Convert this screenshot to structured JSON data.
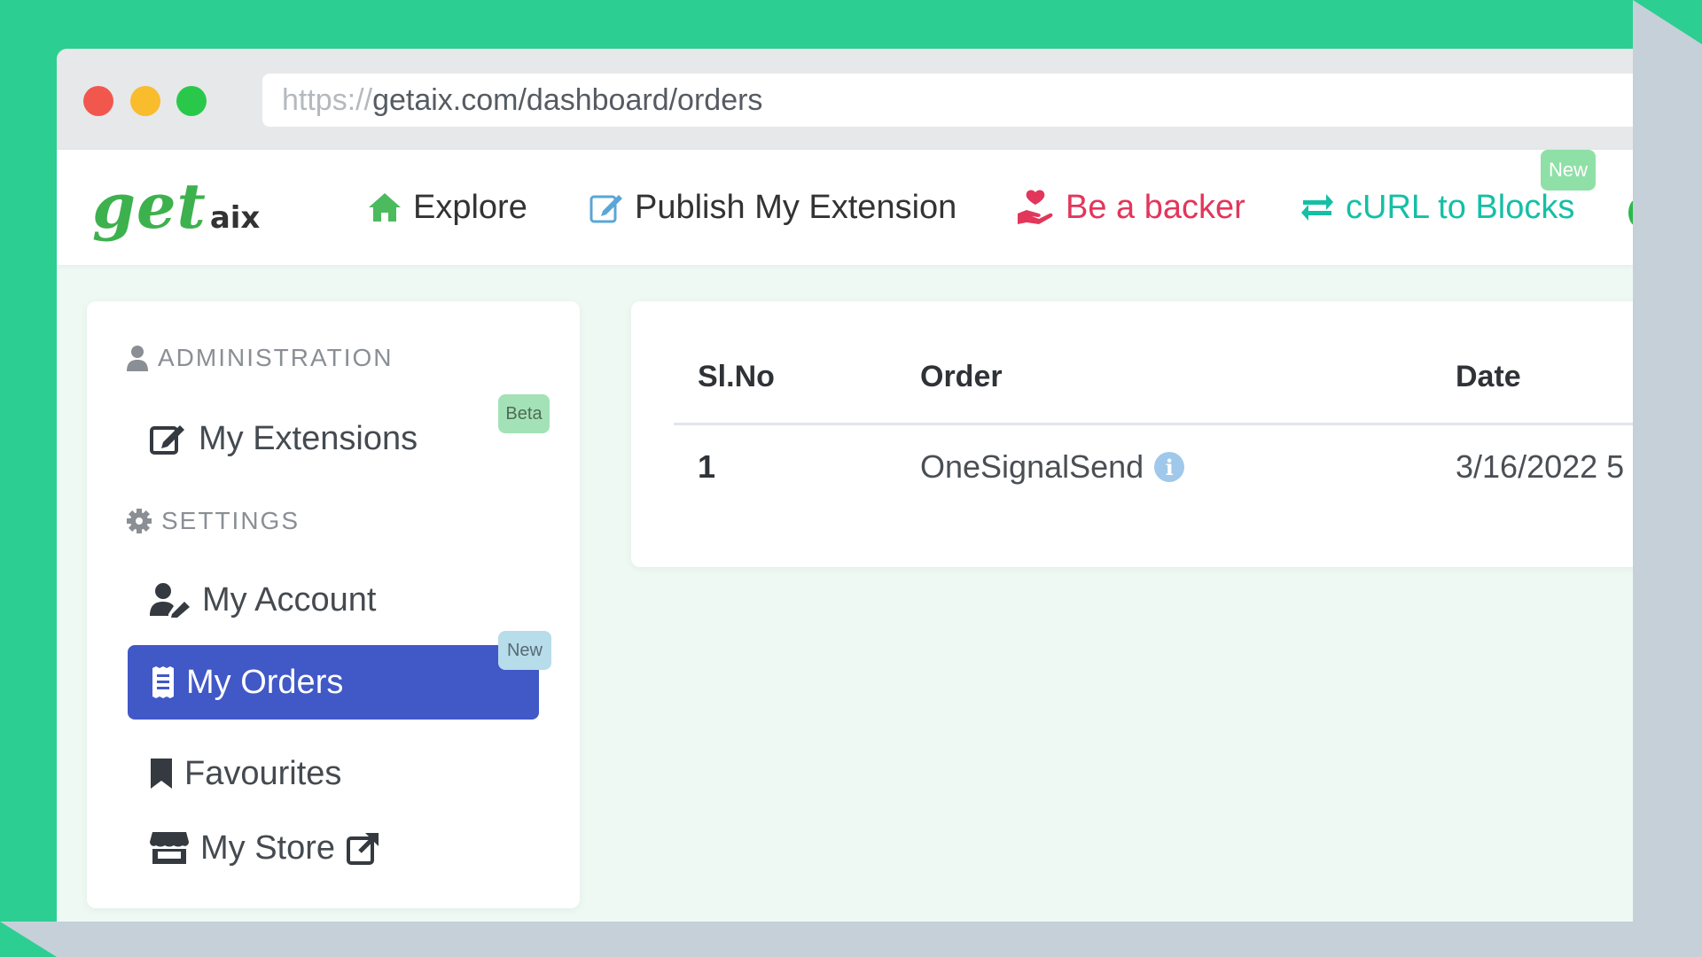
{
  "browser": {
    "url_protocol": "https://",
    "url_path": "getaix.com/dashboard/orders"
  },
  "logo": {
    "main": "get",
    "sub": "aix"
  },
  "nav": {
    "explore": "Explore",
    "publish": "Publish My Extension",
    "backer": "Be a backer",
    "curl": "cURL to Blocks",
    "new_badge": "New"
  },
  "sidebar": {
    "administration": "ADMINISTRATION",
    "my_extensions": "My Extensions",
    "beta_badge": "Beta",
    "settings": "SETTINGS",
    "my_account": "My Account",
    "my_orders": "My Orders",
    "orders_badge": "New",
    "favourites": "Favourites",
    "my_store": "My Store"
  },
  "table": {
    "columns": [
      "Sl.No",
      "Order",
      "Date"
    ],
    "rows": [
      {
        "slno": "1",
        "order": "OneSignalSend",
        "date": "3/16/2022 5"
      }
    ]
  },
  "colors": {
    "accent": "#4158c7",
    "brand_green": "#3db14d",
    "backer": "#e2365b",
    "curl": "#15bfa6"
  }
}
